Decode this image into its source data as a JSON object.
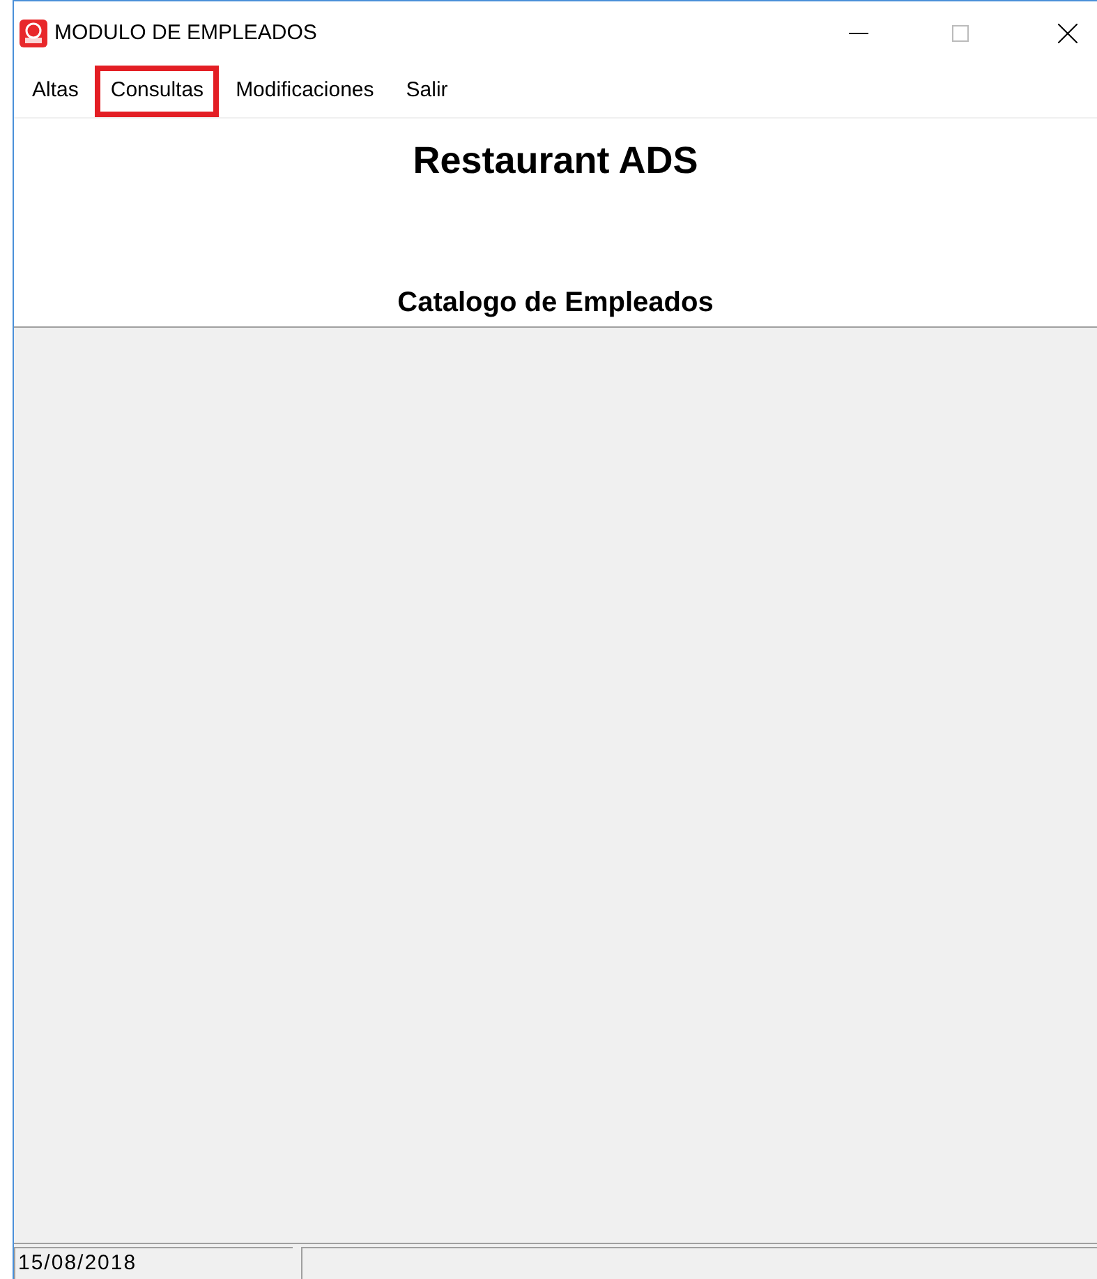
{
  "window": {
    "title": "MODULO DE EMPLEADOS"
  },
  "menu": [
    {
      "label": "Altas",
      "highlighted": false
    },
    {
      "label": "Consultas",
      "highlighted": true
    },
    {
      "label": "Modificaciones",
      "highlighted": false
    },
    {
      "label": "Salir",
      "highlighted": false
    }
  ],
  "header": {
    "title": "Restaurant ADS",
    "subtitle": "Catalogo de Empleados"
  },
  "status_bar": {
    "date": "15/08/2018"
  }
}
